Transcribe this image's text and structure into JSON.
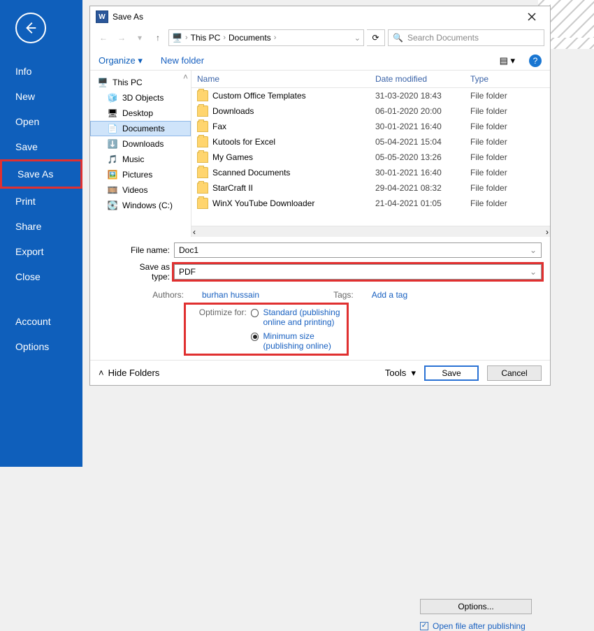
{
  "word_nav": {
    "items": [
      "Info",
      "New",
      "Open",
      "Save",
      "Save As",
      "Print",
      "Share",
      "Export",
      "Close"
    ],
    "account_items": [
      "Account",
      "Options"
    ]
  },
  "dialog": {
    "title": "Save As",
    "breadcrumb": {
      "root": "This PC",
      "folder": "Documents"
    },
    "search_placeholder": "Search Documents",
    "organize_label": "Organize",
    "newfolder_label": "New folder",
    "tree": [
      {
        "icon": "pc-icon",
        "label": "This PC"
      },
      {
        "icon": "cube-icon",
        "label": "3D Objects"
      },
      {
        "icon": "desktop-icon",
        "label": "Desktop"
      },
      {
        "icon": "doc-icon",
        "label": "Documents",
        "selected": true
      },
      {
        "icon": "download-icon",
        "label": "Downloads"
      },
      {
        "icon": "music-icon",
        "label": "Music"
      },
      {
        "icon": "picture-icon",
        "label": "Pictures"
      },
      {
        "icon": "video-icon",
        "label": "Videos"
      },
      {
        "icon": "disk-icon",
        "label": "Windows (C:)"
      }
    ],
    "columns": {
      "name": "Name",
      "date": "Date modified",
      "type": "Type"
    },
    "rows": [
      {
        "name": "Custom Office Templates",
        "date": "31-03-2020 18:43",
        "type": "File folder"
      },
      {
        "name": "Downloads",
        "date": "06-01-2020 20:00",
        "type": "File folder"
      },
      {
        "name": "Fax",
        "date": "30-01-2021 16:40",
        "type": "File folder"
      },
      {
        "name": "Kutools for Excel",
        "date": "05-04-2021 15:04",
        "type": "File folder"
      },
      {
        "name": "My Games",
        "date": "05-05-2020 13:26",
        "type": "File folder"
      },
      {
        "name": "Scanned Documents",
        "date": "30-01-2021 16:40",
        "type": "File folder"
      },
      {
        "name": "StarCraft II",
        "date": "29-04-2021 08:32",
        "type": "File folder"
      },
      {
        "name": "WinX YouTube Downloader",
        "date": "21-04-2021 01:05",
        "type": "File folder"
      }
    ],
    "filename_label": "File name:",
    "filename_value": "Doc1",
    "saveastype_label": "Save as type:",
    "saveastype_value": "PDF",
    "authors_label": "Authors:",
    "authors_value": "burhan hussain",
    "tags_label": "Tags:",
    "tags_value": "Add a tag",
    "optimize_label": "Optimize for:",
    "optimize_std": "Standard (publishing online and printing)",
    "optimize_min": "Minimum size (publishing online)",
    "options_btn": "Options...",
    "openfile_chk": "Open file after publishing",
    "tools_label": "Tools",
    "save_btn": "Save",
    "cancel_btn": "Cancel",
    "hidefolders": "Hide Folders"
  }
}
